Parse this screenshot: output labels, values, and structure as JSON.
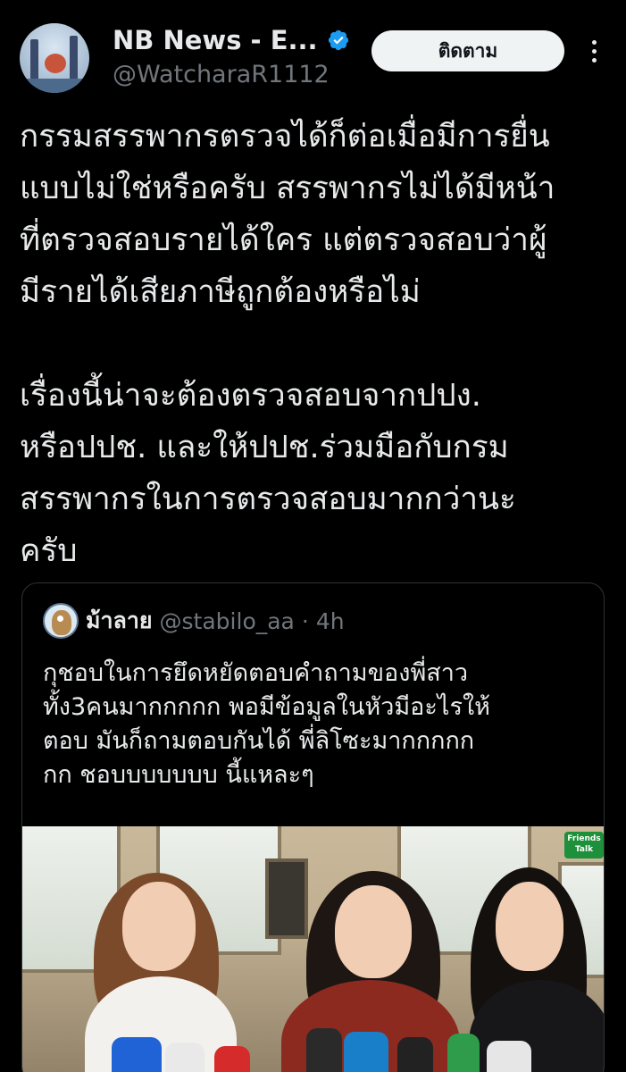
{
  "author": {
    "display_name": "NB News - E...",
    "handle": "@WatcharaR1112",
    "verified": true,
    "verified_color": "#1d9bf0"
  },
  "actions": {
    "follow_label": "ติดตาม"
  },
  "tweet": {
    "lines_1": [
      "กรรมสรรพากรตรวจได้ก็ต่อเมื่อมีการยื่น",
      "แบบไม่ใช่หรือครับ สรรพากรไม่ได้มีหน้า",
      "ที่ตรวจสอบรายได้ใคร แต่ตรวจสอบว่าผู้",
      "มีรายได้เสียภาษีถูกต้องหรือไม่"
    ],
    "lines_2": [
      "เรื่องนี้น่าจะต้องตรวจสอบจากปปง.",
      "หรือปปช. และให้ปปช.ร่วมมือกับกรม",
      "สรรพากรในการตรวจสอบมากกว่านะ",
      "ครับ"
    ]
  },
  "quoted": {
    "name": "ม้าลาย",
    "handle": "@stabilo_aa",
    "separator": "·",
    "time": "4h",
    "lines": [
      "กุชอบในการยึดหยัดตอบคำถามของพี่สาว",
      "ทั้ง3คนมากกกกก พอมีข้อมูลในหัวมีอะไรให้",
      "ตอบ มันก็ถามตอบกันได้ พี่ลิโซะมากกกกก",
      "กก ชอบบบบบบบ นี้แหละๆ"
    ],
    "media_badge": "Friends Talk"
  },
  "colors": {
    "background": "#000000",
    "text": "#e7e9ea",
    "secondary_text": "#71767b",
    "border": "#2f3336",
    "follow_bg": "#eff3f4"
  }
}
